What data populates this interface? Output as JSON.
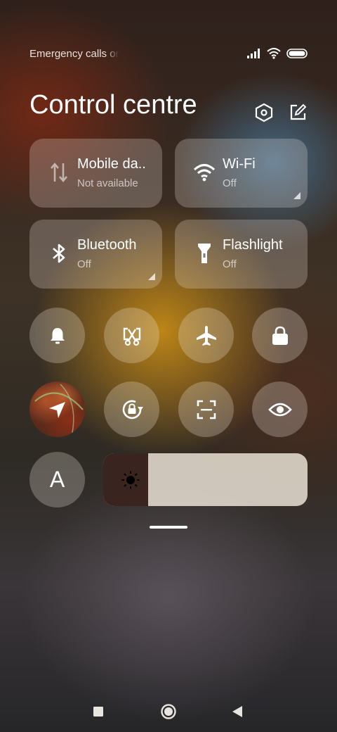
{
  "status_bar": {
    "carrier_text": "Emergency calls only",
    "signal_icon": "signal-bars-icon",
    "wifi_icon": "wifi-icon",
    "battery_icon": "battery-icon"
  },
  "header": {
    "title": "Control centre",
    "settings_icon": "settings-hexagon-icon",
    "edit_icon": "edit-icon"
  },
  "tiles": [
    {
      "label": "Mobile da..",
      "sub": "Not available",
      "icon": "mobile-data-icon"
    },
    {
      "label": "Wi-Fi",
      "sub": "Off",
      "icon": "wifi-icon"
    },
    {
      "label": "Bluetooth",
      "sub": "Off",
      "icon": "bluetooth-icon"
    },
    {
      "label": "Flashlight",
      "sub": "Off",
      "icon": "flashlight-icon"
    }
  ],
  "toggles_row1": [
    "bell-icon",
    "screenshot-icon",
    "airplane-icon",
    "lock-icon"
  ],
  "toggles_row2": [
    "location-icon",
    "auto-rotate-icon",
    "scan-icon",
    "eye-icon"
  ],
  "reading_mode_icon": "font-size-icon",
  "reading_mode_label": "A",
  "brightness": {
    "level": 0.22,
    "icon": "brightness-sun-icon"
  },
  "navigation": [
    "recents-square-icon",
    "home-circle-icon",
    "back-triangle-icon"
  ],
  "colors": {
    "tile_bg": "rgba(235,225,215,0.26)",
    "brightness_track": "#dcd4c8",
    "brightness_fill": "#3a2420"
  }
}
